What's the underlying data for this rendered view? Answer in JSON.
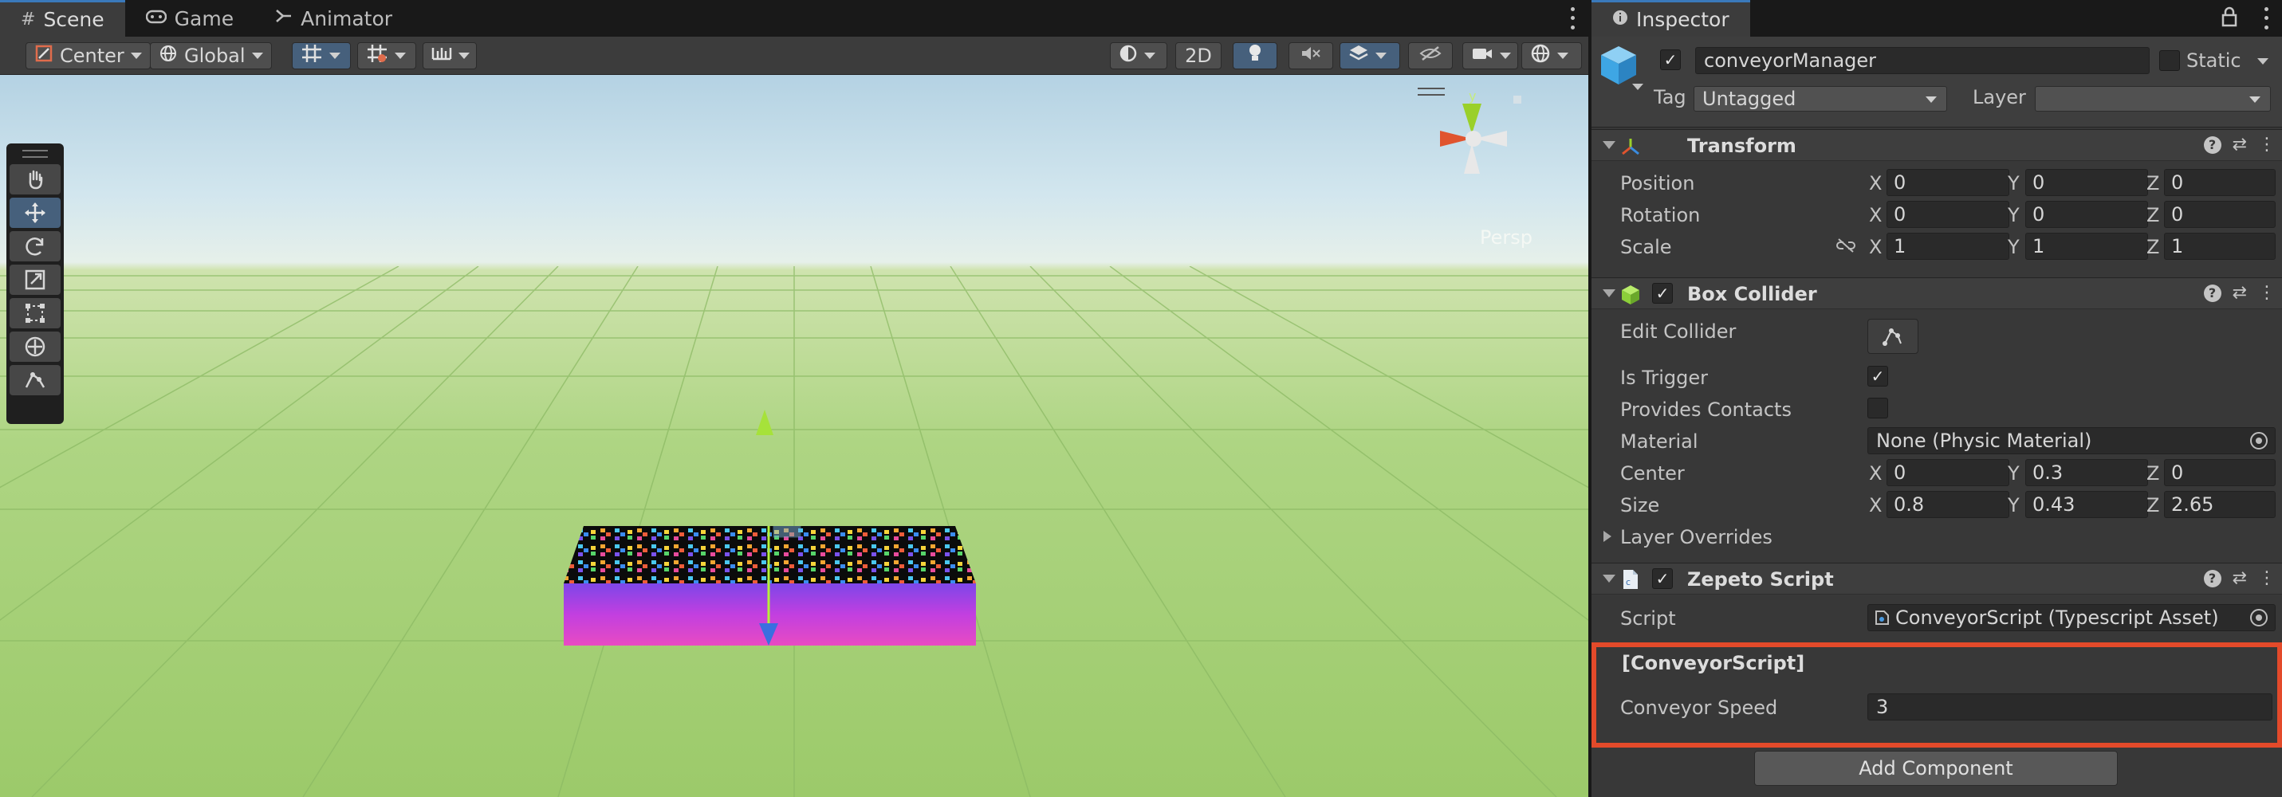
{
  "scene_panel": {
    "tabs": [
      {
        "label": "Scene",
        "icon": "hash-icon"
      },
      {
        "label": "Game",
        "icon": "gamepad-icon"
      },
      {
        "label": "Animator",
        "icon": "animator-icon"
      }
    ],
    "toolbar": {
      "pivot_label": "Center",
      "space_label": "Global",
      "mode_2d_label": "2D"
    },
    "view_label": "Persp"
  },
  "inspector": {
    "tab_label": "Inspector",
    "object": {
      "name": "conveyorManager",
      "active": true,
      "static_label": "Static",
      "tag_label": "Tag",
      "tag_value": "Untagged",
      "layer_label": "Layer",
      "layer_value": ""
    },
    "transform": {
      "title": "Transform",
      "position_label": "Position",
      "rotation_label": "Rotation",
      "scale_label": "Scale",
      "position": {
        "x": "0",
        "y": "0",
        "z": "0"
      },
      "rotation": {
        "x": "0",
        "y": "0",
        "z": "0"
      },
      "scale": {
        "x": "1",
        "y": "1",
        "z": "1"
      }
    },
    "box_collider": {
      "title": "Box Collider",
      "enabled": true,
      "edit_collider_label": "Edit Collider",
      "is_trigger_label": "Is Trigger",
      "is_trigger": true,
      "provides_contacts_label": "Provides Contacts",
      "provides_contacts": false,
      "material_label": "Material",
      "material_value": "None (Physic Material)",
      "center_label": "Center",
      "center": {
        "x": "0",
        "y": "0.3",
        "z": "0"
      },
      "size_label": "Size",
      "size": {
        "x": "0.8",
        "y": "0.43",
        "z": "2.65"
      },
      "layer_overrides_label": "Layer Overrides"
    },
    "zepeto_script": {
      "title": "Zepeto Script",
      "enabled": true,
      "script_label": "Script",
      "script_value": "ConveyorScript (Typescript Asset)",
      "section_label": "[ConveyorScript]",
      "conveyor_speed_label": "Conveyor Speed",
      "conveyor_speed_value": "3"
    },
    "axis_labels": {
      "x": "X",
      "y": "Y",
      "z": "Z"
    },
    "add_component_label": "Add Component"
  },
  "colors": {
    "highlight": "#e34a2a",
    "accent_blue": "#3a79bb",
    "panel_bg": "#383838"
  }
}
